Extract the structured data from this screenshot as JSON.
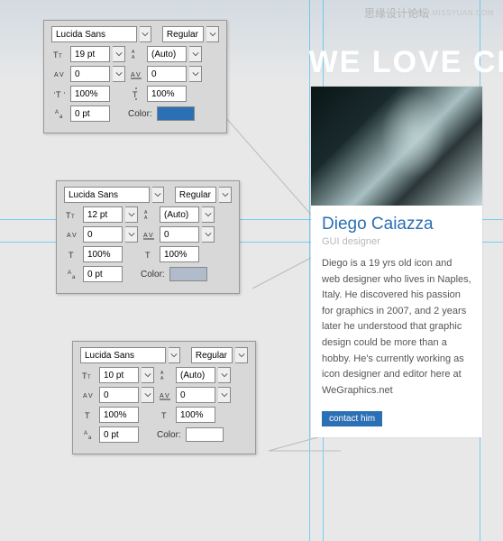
{
  "watermarks": {
    "site": "思缘设计论坛",
    "url": "WWW.MISSYUAN.COM"
  },
  "headline": "WE LOVE CR",
  "panels": [
    {
      "font_name": "Lucida Sans",
      "font_style": "Regular",
      "size": "19 pt",
      "leading": "(Auto)",
      "va": "0",
      "tracking": "0",
      "h_scale": "100%",
      "v_scale": "100%",
      "baseline": "0 pt",
      "color": "#2b6fb5"
    },
    {
      "font_name": "Lucida Sans",
      "font_style": "Regular",
      "size": "12 pt",
      "leading": "(Auto)",
      "va": "0",
      "tracking": "0",
      "h_scale": "100%",
      "v_scale": "100%",
      "baseline": "0 pt",
      "color": "#b0bccc"
    },
    {
      "font_name": "Lucida Sans",
      "font_style": "Regular",
      "size": "10 pt",
      "leading": "(Auto)",
      "va": "0",
      "tracking": "0",
      "h_scale": "100%",
      "v_scale": "100%",
      "baseline": "0 pt",
      "color": "#ffffff"
    }
  ],
  "card": {
    "name": "Diego Caiazza",
    "role": "GUI designer",
    "bio": "Diego is a 19 yrs old icon and web designer who lives in Naples, Italy. He discovered his passion for graphics in 2007, and 2 years later he understood that graphic design could be more than a hobby. He's currently working as icon designer and editor here at WeGraphics.net",
    "contact": "contact him"
  },
  "labels": {
    "color": "Color:"
  }
}
